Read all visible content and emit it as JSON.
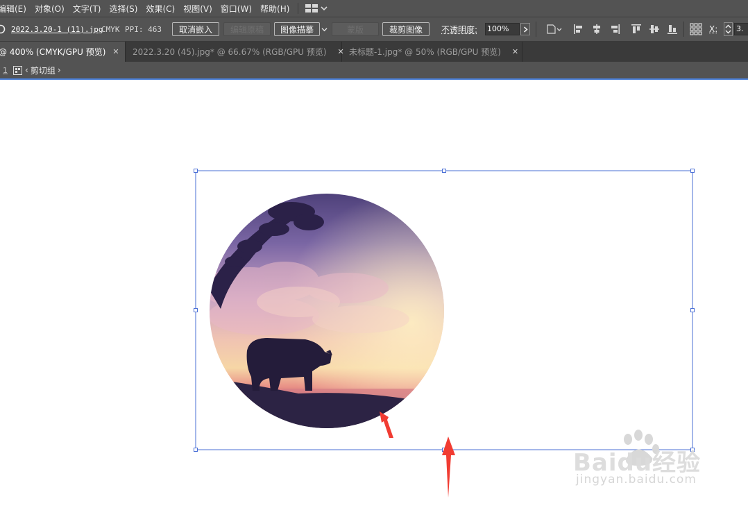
{
  "menu": {
    "items": [
      "编辑(E)",
      "对象(O)",
      "文字(T)",
      "选择(S)",
      "效果(C)",
      "视图(V)",
      "窗口(W)",
      "帮助(H)"
    ]
  },
  "control_bar": {
    "file_name": "2022.3.20-1 (11).jpg",
    "color_mode": "CMYK",
    "ppi": "PPI: 463",
    "unembed_button": "取消嵌入",
    "edit_original_button": "编辑原稿",
    "image_trace_button": "图像描摹",
    "mask_button": "蒙版",
    "crop_image_button": "裁剪图像",
    "opacity_label": "不透明度:",
    "opacity_value": "100%",
    "x_label": "X:",
    "x_value": "3.",
    "icons": [
      "document-setup-icon",
      "align-left-icon",
      "align-center-h-icon",
      "align-right-icon",
      "align-top-icon",
      "align-middle-v-icon",
      "align-bottom-icon",
      "transform-grid-icon"
    ]
  },
  "tabs": [
    {
      "label": "@ 400% (CMYK/GPU 预览)",
      "active": true
    },
    {
      "label": "2022.3.20 (45).jpg* @ 66.67% (RGB/GPU 预览)",
      "active": false
    },
    {
      "label": "未标题-1.jpg* @ 50% (RGB/GPU 预览)",
      "active": false
    }
  ],
  "breadcrumb": {
    "prefix": "1",
    "group_label": "剪切组"
  },
  "watermark": {
    "brand": "Baidu经验",
    "url": "jingyan.baidu.com"
  },
  "colors": {
    "selection": "#4a6fd6",
    "arrow": "#f13c32",
    "panel": "#535353",
    "tab_bar": "#3a3a3a"
  }
}
